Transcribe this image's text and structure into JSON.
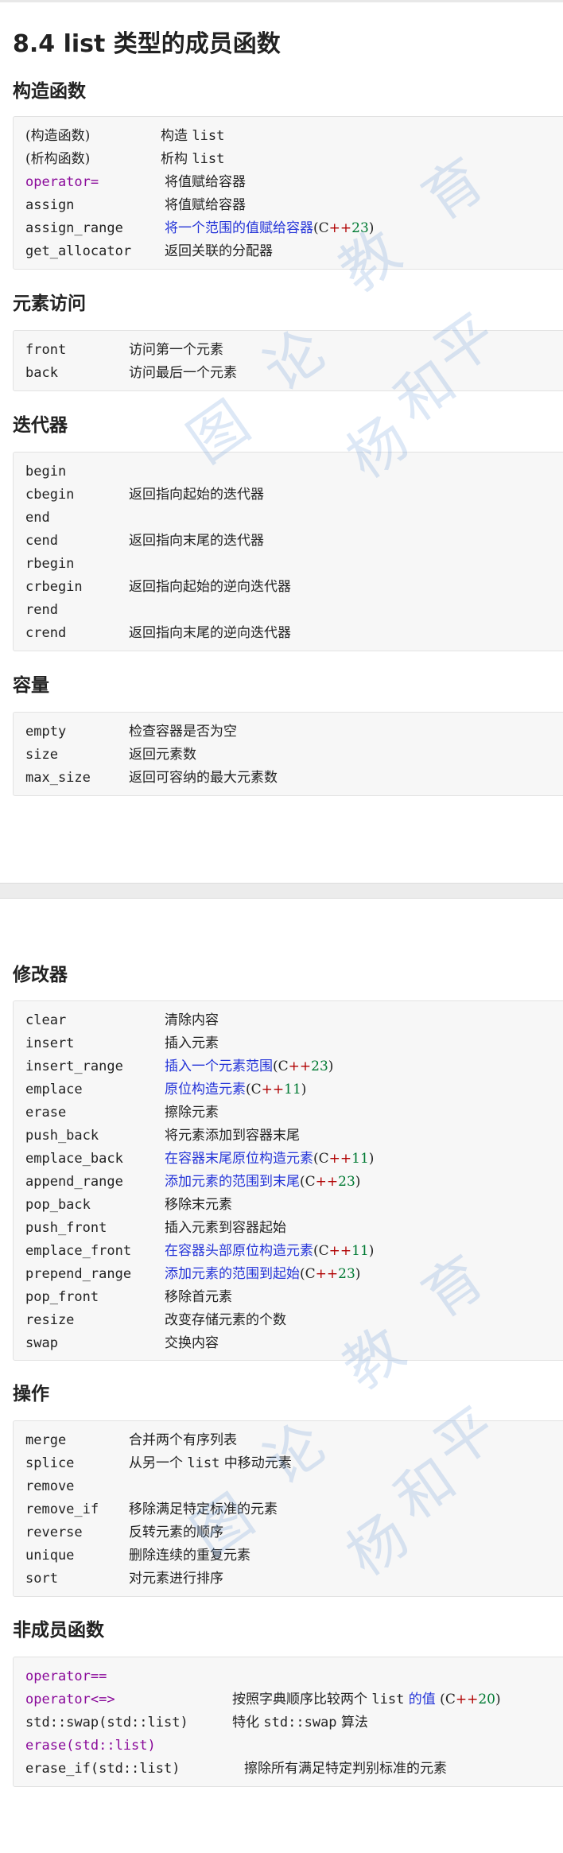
{
  "title": "8.4 list 类型的成员函数",
  "sections": {
    "ctor": {
      "heading": "构造函数",
      "rows": [
        {
          "name": "(构造函数)",
          "desc": "构造 ",
          "desc_code": "list"
        },
        {
          "name": "(析构函数)",
          "desc": "析构 ",
          "desc_code": "list"
        },
        {
          "name": "operator=",
          "desc": "将值赋给容器"
        },
        {
          "name": "assign",
          "desc": "将值赋给容器"
        },
        {
          "name": "assign_range",
          "desc": "将一个范围的值赋给容器",
          "ver_pre": "(",
          "ver_c": "C",
          "ver_pp": "++",
          "ver_num": "23",
          "ver_post": ")"
        },
        {
          "name": "get_allocator",
          "desc": "返回关联的分配器"
        }
      ]
    },
    "access": {
      "heading": "元素访问",
      "rows": [
        {
          "name": "front",
          "desc": "访问第一个元素"
        },
        {
          "name": "back",
          "desc": "访问最后一个元素"
        }
      ]
    },
    "iter": {
      "heading": "迭代器",
      "rows": [
        {
          "name": "begin",
          "desc": ""
        },
        {
          "name": "cbegin",
          "desc": "返回指向起始的迭代器"
        },
        {
          "name": "end",
          "desc": ""
        },
        {
          "name": "cend",
          "desc": "返回指向末尾的迭代器"
        },
        {
          "name": "rbegin",
          "desc": ""
        },
        {
          "name": "crbegin",
          "desc": "返回指向起始的逆向迭代器"
        },
        {
          "name": "rend",
          "desc": ""
        },
        {
          "name": "crend",
          "desc": "返回指向末尾的逆向迭代器"
        }
      ]
    },
    "cap": {
      "heading": "容量",
      "rows": [
        {
          "name": "empty",
          "desc": "检查容器是否为空"
        },
        {
          "name": "size",
          "desc": "返回元素数"
        },
        {
          "name": "max_size",
          "desc": "返回可容纳的最大元素数"
        }
      ]
    },
    "mod": {
      "heading": "修改器",
      "rows": [
        {
          "name": "clear",
          "desc": "清除内容"
        },
        {
          "name": "insert",
          "desc": "插入元素"
        },
        {
          "name": "insert_range",
          "desc": "插入一个元素范围",
          "ver_pre": "(",
          "ver_c": "C",
          "ver_pp": "++",
          "ver_num": "23",
          "ver_post": ")"
        },
        {
          "name": "emplace",
          "desc": "原位构造元素",
          "ver_pre": "(",
          "ver_c": "C",
          "ver_pp": "++",
          "ver_num": "11",
          "ver_post": ")"
        },
        {
          "name": "erase",
          "desc": "擦除元素"
        },
        {
          "name": "push_back",
          "desc": "将元素添加到容器末尾"
        },
        {
          "name": "emplace_back",
          "desc": "在容器末尾原位构造元素",
          "ver_pre": "(",
          "ver_c": "C",
          "ver_pp": "++",
          "ver_num": "11",
          "ver_post": ")"
        },
        {
          "name": "append_range",
          "desc": "添加元素的范围到末尾",
          "ver_pre": "(",
          "ver_c": "C",
          "ver_pp": "++",
          "ver_num": "23",
          "ver_post": ")"
        },
        {
          "name": "pop_back",
          "desc": "移除末元素"
        },
        {
          "name": "push_front",
          "desc": "插入元素到容器起始"
        },
        {
          "name": "emplace_front",
          "desc": "在容器头部原位构造元素",
          "ver_pre": "(",
          "ver_c": "C",
          "ver_pp": "++",
          "ver_num": "11",
          "ver_post": ")"
        },
        {
          "name": "prepend_range",
          "desc": "添加元素的范围到起始",
          "ver_pre": "(",
          "ver_c": "C",
          "ver_pp": "++",
          "ver_num": "23",
          "ver_post": ")"
        },
        {
          "name": "pop_front",
          "desc": "移除首元素"
        },
        {
          "name": "resize",
          "desc": "改变存储元素的个数"
        },
        {
          "name": "swap",
          "desc": "交换内容"
        }
      ]
    },
    "ops": {
      "heading": "操作",
      "rows": [
        {
          "name": "merge",
          "desc": "合并两个有序列表"
        },
        {
          "name": "splice",
          "desc": "从另一个 ",
          "desc_code": "list",
          "desc_tail": " 中移动元素"
        },
        {
          "name": "remove",
          "desc": ""
        },
        {
          "name": "remove_if",
          "desc": "移除满足特定标准的元素"
        },
        {
          "name": "reverse",
          "desc": "反转元素的顺序"
        },
        {
          "name": "unique",
          "desc": "删除连续的重复元素"
        },
        {
          "name": "sort",
          "desc": "对元素进行排序"
        }
      ]
    },
    "nonmem": {
      "heading": "非成员函数",
      "rows": [
        {
          "name": "operator==",
          "desc": ""
        },
        {
          "name": "operator<=>",
          "desc": "按照字典顺序比较两个 ",
          "desc_code": "list",
          "desc_link": " 的值",
          "ver_pre": " (",
          "ver_c": "C",
          "ver_pp": "++",
          "ver_num": "20",
          "ver_post": ")"
        },
        {
          "name": "std::swap(std::list)",
          "desc": "特化 ",
          "desc_code": "std::swap",
          "desc_tail": " 算法"
        },
        {
          "name": "erase(std::list)",
          "desc": ""
        },
        {
          "name": "erase_if(std::list)",
          "desc": "擦除所有满足特定判别标准的元素"
        }
      ]
    }
  },
  "watermark": [
    "图",
    "论",
    "教",
    "育",
    "杨",
    "和",
    "平"
  ],
  "colors": {
    "keyword": "#8a0a9a",
    "link": "#2434d8",
    "version_number": "#007a33",
    "plusplus": "#b00000",
    "box_bg": "#f7f7f7"
  }
}
